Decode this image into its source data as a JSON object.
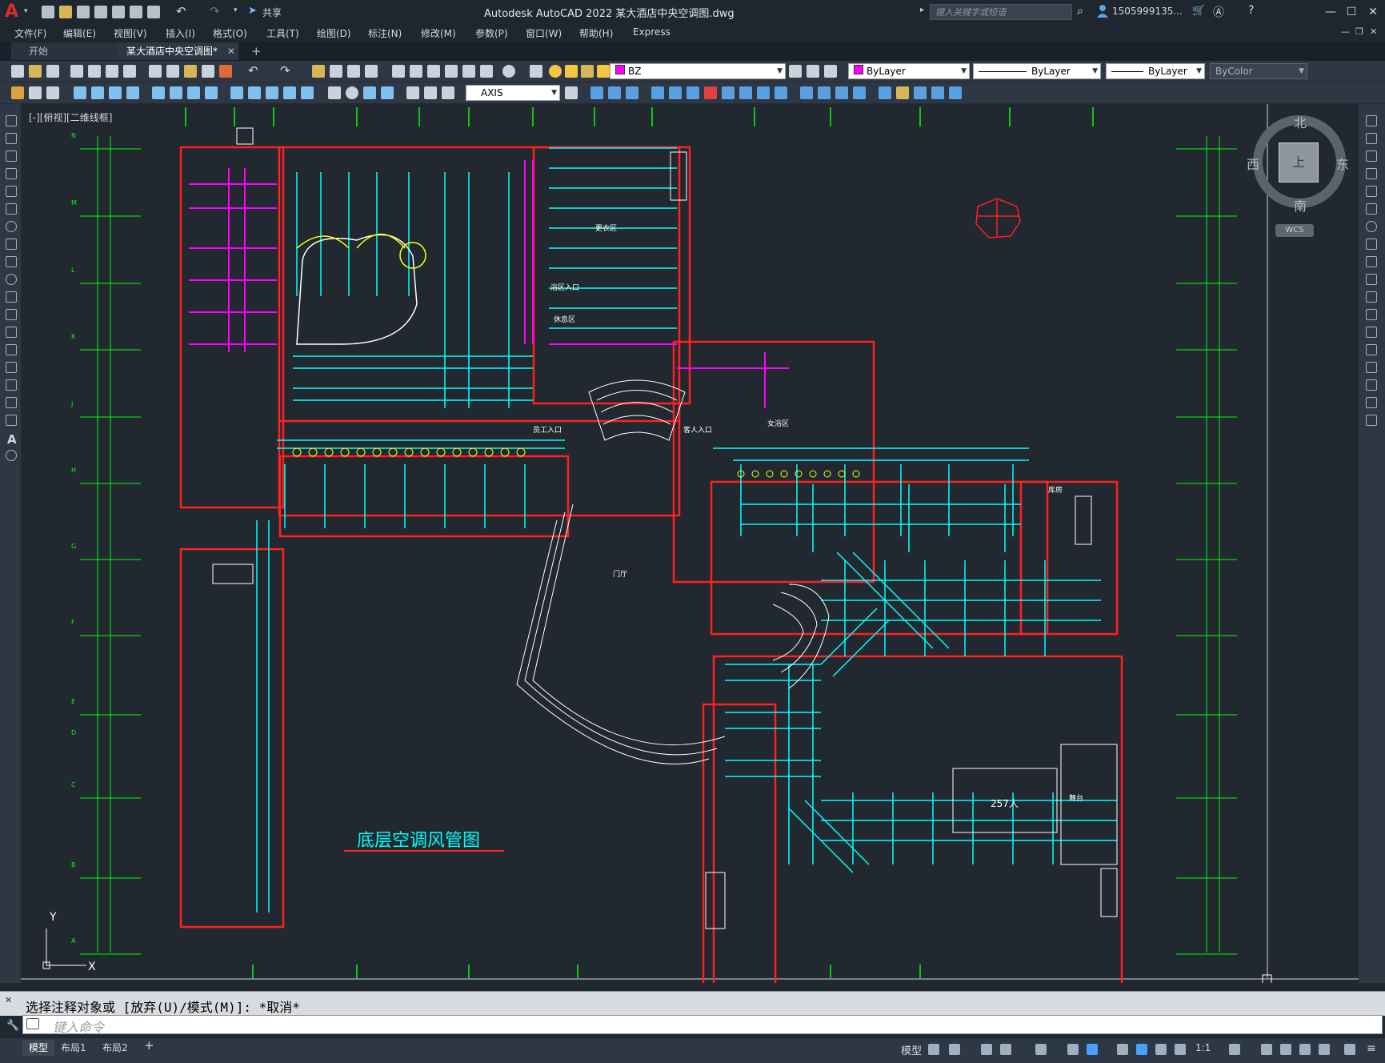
{
  "app": {
    "logo": "A",
    "title": "Autodesk AutoCAD 2022    某大酒店中央空调图.dwg",
    "share_label": "共享",
    "search_placeholder": "键入关键字或短语",
    "user": "1505999135...",
    "window_controls": [
      "minimize-icon",
      "maximize-icon",
      "close-icon"
    ]
  },
  "menu": [
    "文件(F)",
    "编辑(E)",
    "视图(V)",
    "插入(I)",
    "格式(O)",
    "工具(T)",
    "绘图(D)",
    "标注(N)",
    "修改(M)",
    "参数(P)",
    "窗口(W)",
    "帮助(H)",
    "Express"
  ],
  "tabs": [
    {
      "label": "开始",
      "active": false
    },
    {
      "label": "某大酒店中央空调图*",
      "active": true
    }
  ],
  "toolbar": {
    "layer_name": "BZ",
    "layer_color": "#ff00ff",
    "color_value": "ByLayer",
    "linetype_value": "ByLayer",
    "lineweight_value": "ByLayer",
    "plotstyle_value": "ByColor",
    "dimstyle_value": "AXIS"
  },
  "viewport": {
    "label": "[-][俯视][二维线框]",
    "viewcube": {
      "north": "北",
      "south": "南",
      "east": "东",
      "west": "西",
      "face": "上",
      "wcs": "WCS"
    }
  },
  "drawing": {
    "title": "底层空调风管图",
    "room_count_label": "257人",
    "labels": {
      "lobby": "门厅",
      "guest_entry": "客人入口",
      "staff_entry": "员工入口",
      "bathing_entry": "浴区入口",
      "changing": "更衣区",
      "rest": "休息区",
      "female_bathing": "女浴区",
      "stage": "舞台",
      "storage": "库房"
    },
    "axis_rows": [
      "N",
      "M",
      "L",
      "K",
      "J",
      "H",
      "G",
      "F",
      "E",
      "D",
      "C",
      "B",
      "A"
    ]
  },
  "command": {
    "history": "选择注释对象或 [放弃(U)/模式(M)]: *取消*",
    "placeholder": "键入命令"
  },
  "layout_tabs": [
    "模型",
    "布局1",
    "布局2"
  ],
  "status": {
    "mode_label": "模型",
    "scale": "1:1"
  },
  "colors": {
    "canvas": "#212830",
    "wall": "#ff2020",
    "duct": "#00ffff",
    "grid_axis": "#00ff00",
    "pipe_magenta": "#ff00ff",
    "fixture_yellow": "#ffff00"
  }
}
